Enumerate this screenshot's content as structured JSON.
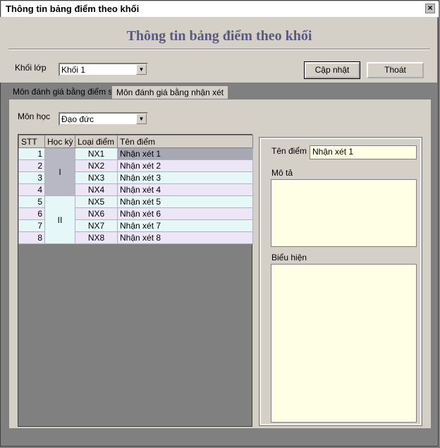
{
  "window": {
    "title": "Thông tin bảng điểm theo khối",
    "close_glyph": "×"
  },
  "header": {
    "title": "Thông tin bảng điểm theo khối"
  },
  "filters": {
    "khoi_label": "Khối lớp",
    "khoi_value": "Khối 1"
  },
  "buttons": {
    "update": "Cập nhật",
    "exit": "Thoát"
  },
  "tabs": [
    {
      "label": "Môn đánh giá bằng điểm số",
      "active": false
    },
    {
      "label": "Môn đánh giá bằng nhận xét",
      "active": true
    }
  ],
  "subject": {
    "label": "Môn học",
    "value": "Đạo đức"
  },
  "table": {
    "headers": [
      "STT",
      "Học kỳ",
      "Loại điểm",
      "Tên điểm"
    ],
    "semesters": [
      "I",
      "II"
    ],
    "rows": [
      {
        "stt": "1",
        "loai": "NX1",
        "ten": "Nhận xét 1"
      },
      {
        "stt": "2",
        "loai": "NX2",
        "ten": "Nhận xét 2"
      },
      {
        "stt": "3",
        "loai": "NX3",
        "ten": "Nhận xét 3"
      },
      {
        "stt": "4",
        "loai": "NX4",
        "ten": "Nhận xét 4"
      },
      {
        "stt": "5",
        "loai": "NX5",
        "ten": "Nhận xét 5"
      },
      {
        "stt": "6",
        "loai": "NX6",
        "ten": "Nhận xét 6"
      },
      {
        "stt": "7",
        "loai": "NX7",
        "ten": "Nhận xét 7"
      },
      {
        "stt": "8",
        "loai": "NX8",
        "ten": "Nhận xét 8"
      }
    ]
  },
  "detail": {
    "ten_label": "Tên điểm",
    "ten_value": "Nhận xét 1",
    "mota_label": "Mô tả",
    "mota_value": "",
    "bieuhien_label": "Biểu hiện",
    "bieuhien_value": ""
  },
  "colors": {
    "title_text": "#5a5a80",
    "row_cyan": "#e6f7f7",
    "row_lavender": "#ece6f7",
    "selected": "#a8a8b4",
    "textbox": "#ffffe6"
  },
  "icons": {
    "dropdown": "chevron-down-icon",
    "close": "close-icon"
  }
}
